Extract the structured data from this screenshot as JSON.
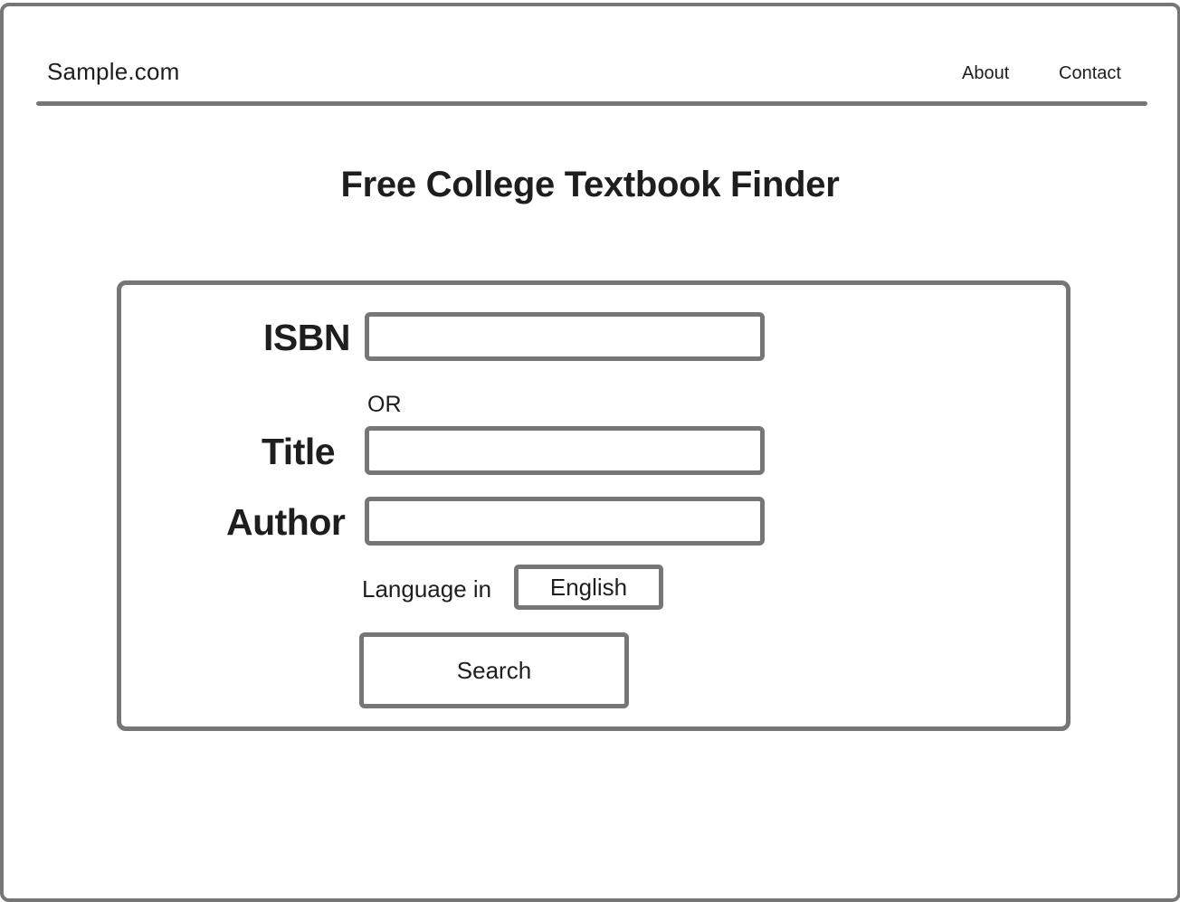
{
  "header": {
    "brand": "Sample.com",
    "nav": {
      "about": "About",
      "contact": "Contact"
    }
  },
  "main": {
    "title": "Free College Textbook Finder",
    "form": {
      "isbn_label": "ISBN",
      "isbn_value": "",
      "or_text": "OR",
      "title_label": "Title",
      "title_value": "",
      "author_label": "Author",
      "author_value": "",
      "language_label": "Language in",
      "language_selected": "English",
      "search_button": "Search"
    }
  },
  "colors": {
    "border": "#767676",
    "text": "#1e1e1e",
    "background": "#ffffff"
  }
}
